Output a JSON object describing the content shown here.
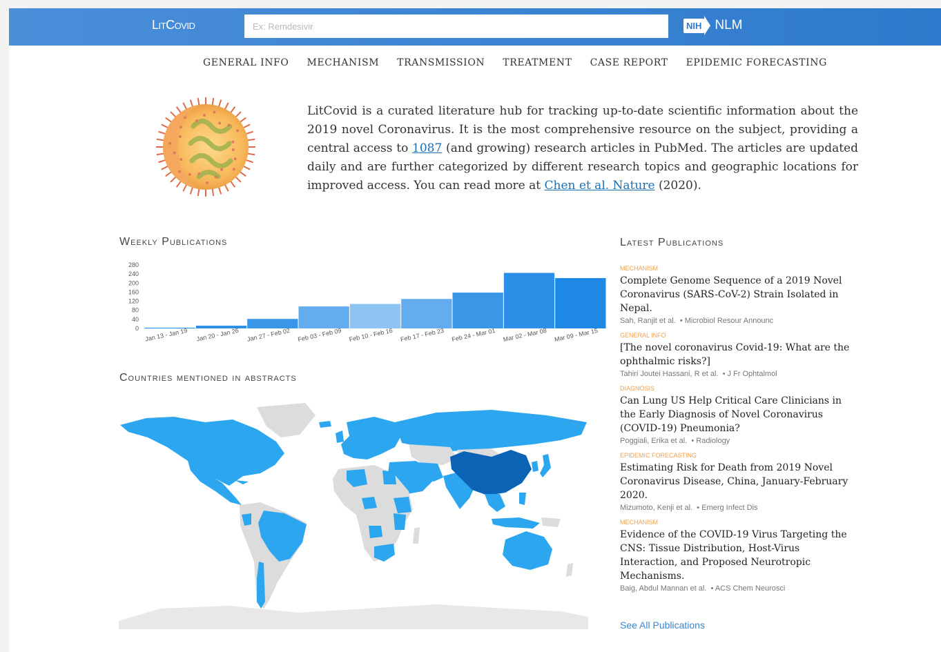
{
  "header": {
    "logo": "LitCovid",
    "search_placeholder": "Ex: Remdesivir",
    "nih_badge": "NIH",
    "nlm_label": "NLM"
  },
  "nav": [
    "GENERAL INFO",
    "MECHANISM",
    "TRANSMISSION",
    "TREATMENT",
    "CASE REPORT",
    "EPIDEMIC FORECASTING"
  ],
  "intro": {
    "part1": "LitCovid is a curated literature hub for tracking up-to-date scientific information about the 2019 novel Coronavirus. It is the most comprehensive resource on the subject, providing a central access to ",
    "count_link": "1087",
    "part2": " (and growing) research articles in PubMed. The articles are updated daily and are further categorized by different research topics and geographic locations for improved access. You can read more at ",
    "ref_link": "Chen et al. Nature",
    "part3": " (2020)."
  },
  "weekly_title": "Weekly Publications",
  "countries_title": "Countries mentioned in abstracts",
  "latest_title": "Latest Publications",
  "colors": {
    "header_blue": "#3f86d5",
    "bar_colors": [
      "#1e88e5",
      "#2b8fe6",
      "#3a97e8",
      "#63acef",
      "#8ec4f4",
      "#63acef",
      "#3a97e8",
      "#2b8fe6",
      "#1e88e5",
      "#1e88e5"
    ],
    "map_high": "#0a63b5",
    "map_mid": "#2ba6ef",
    "map_none": "#dcdcdc",
    "category_orange": "#f0a050"
  },
  "chart_data": {
    "type": "bar",
    "categories": [
      "Jan 13 - Jan 19",
      "Jan 20 - Jan 26",
      "Jan 27 - Feb 02",
      "Feb 03 - Feb 09",
      "Feb 10 - Feb 16",
      "Feb 17 - Feb 23",
      "Feb 24 - Mar 01",
      "Mar 02 - Mar 08",
      "Mar 09 - Mar 15"
    ],
    "values": [
      3,
      12,
      42,
      97,
      108,
      130,
      158,
      245,
      222
    ],
    "yticks": [
      280,
      240,
      200,
      160,
      120,
      80,
      40,
      0
    ],
    "ylim": [
      0,
      280
    ],
    "xlabel": "",
    "ylabel": "",
    "grid": false,
    "legend": "none"
  },
  "publications": [
    {
      "category": "Mechanism",
      "title": "Complete Genome Sequence of a 2019 Novel Coronavirus (SARS-CoV-2) Strain Isolated in Nepal.",
      "authors": "Sah, Ranjit et al.",
      "journal": "Microbiol Resour Announc"
    },
    {
      "category": "General Info",
      "title": "[The novel coronavirus Covid-19: What are the ophthalmic risks?]",
      "authors": "Tahiri Joutei Hassani, R et al.",
      "journal": "J Fr Ophtalmol"
    },
    {
      "category": "Diagnosis",
      "title": "Can Lung US Help Critical Care Clinicians in the Early Diagnosis of Novel Coronavirus (COVID-19) Pneumonia?",
      "authors": "Poggiali, Erika et al.",
      "journal": "Radiology"
    },
    {
      "category": "Epidemic Forecasting",
      "title": "Estimating Risk for Death from 2019 Novel Coronavirus Disease, China, January-February 2020.",
      "authors": "Mizumoto, Kenji et al.",
      "journal": "Emerg Infect Dis"
    },
    {
      "category": "Mechanism",
      "title": "Evidence of the COVID-19 Virus Targeting the CNS: Tissue Distribution, Host-Virus Interaction, and Proposed Neurotropic Mechanisms.",
      "authors": "Baig, Abdul Mannan et al.",
      "journal": "ACS Chem Neurosci"
    }
  ],
  "see_all": "See All Publications"
}
